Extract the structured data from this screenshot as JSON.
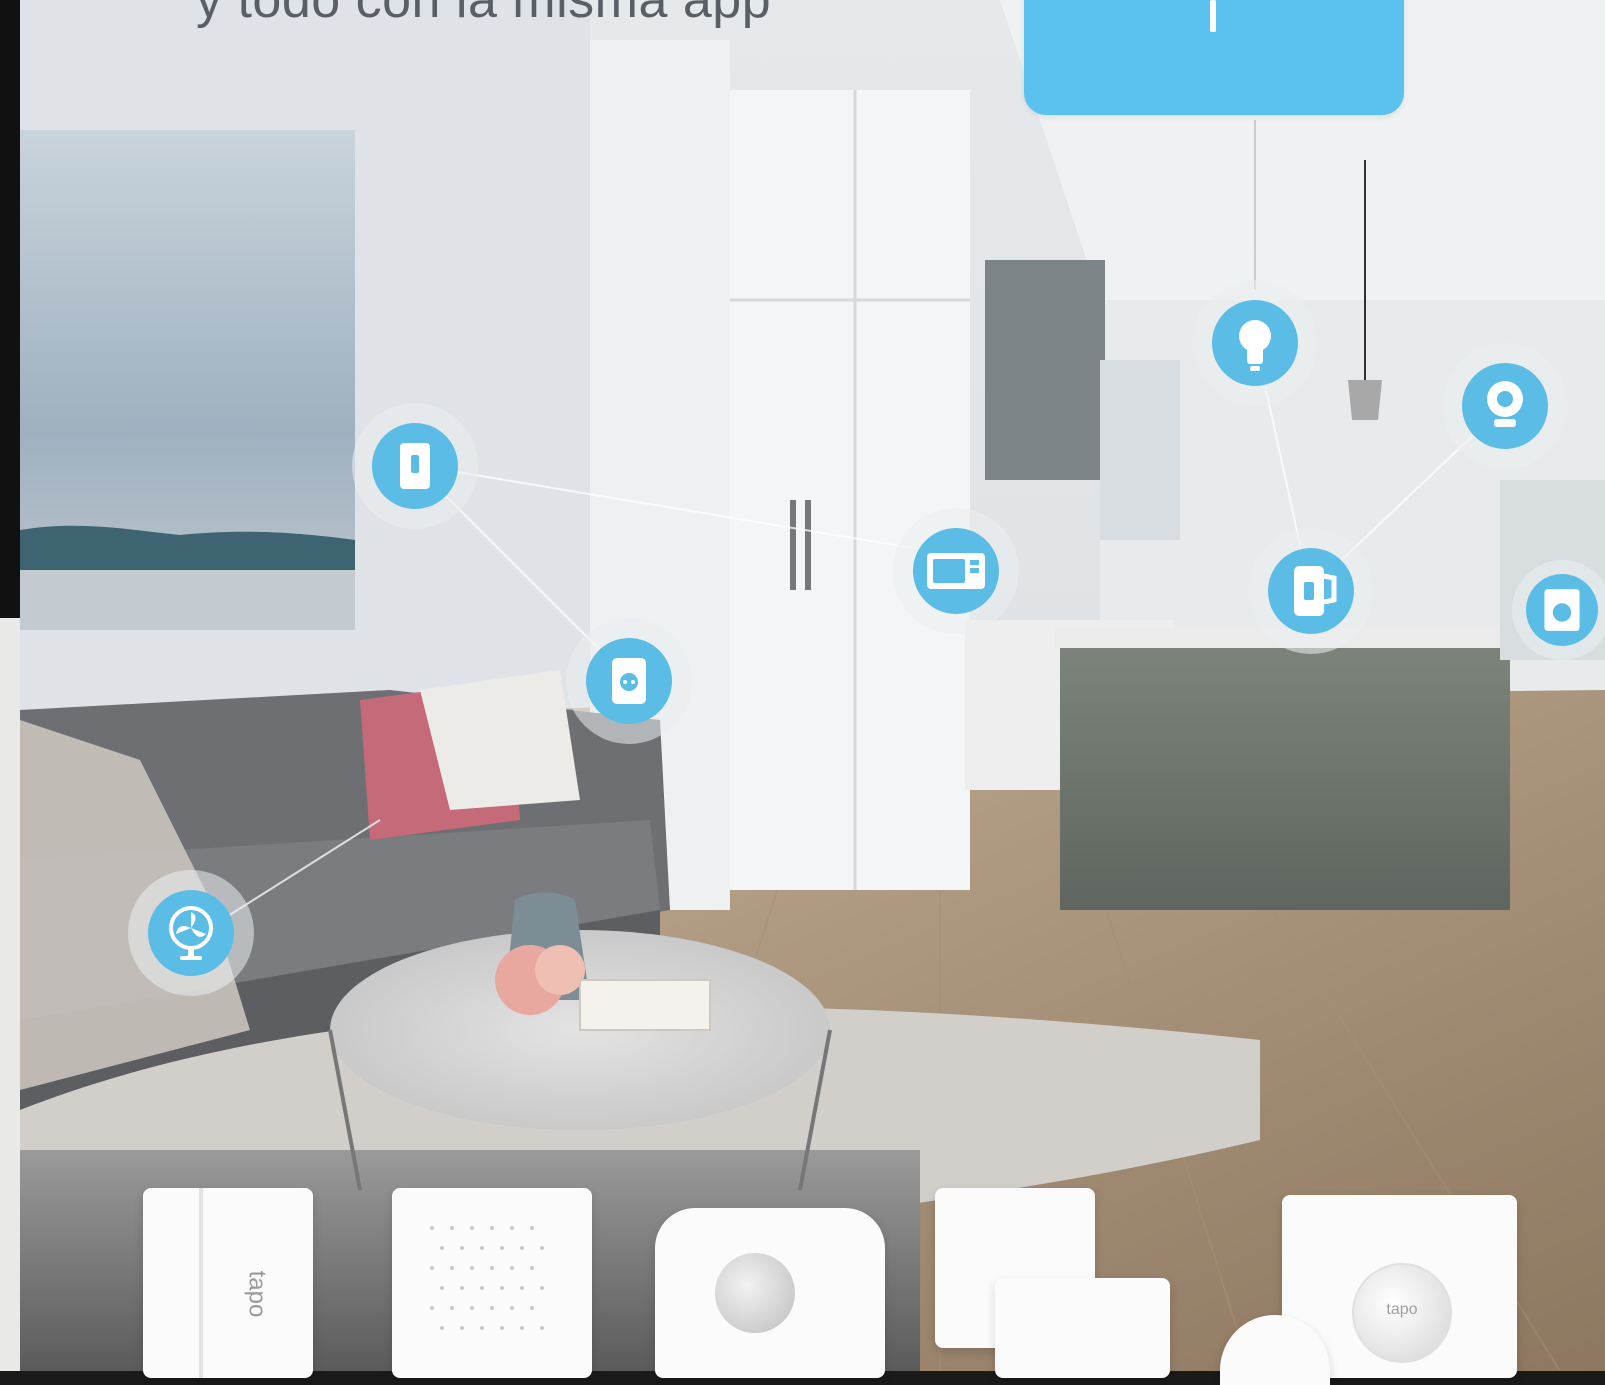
{
  "headline": "y todo con la misma app",
  "brand_text": "tapo",
  "colors": {
    "accent": "#5bc2ef",
    "node_blue": "#5bbce6"
  },
  "devices": [
    {
      "name": "smart-switch-icon"
    },
    {
      "name": "smart-plug-icon"
    },
    {
      "name": "microwave-icon"
    },
    {
      "name": "light-bulb-icon"
    },
    {
      "name": "kettle-icon"
    },
    {
      "name": "camera-icon"
    },
    {
      "name": "washing-machine-icon"
    },
    {
      "name": "fan-icon"
    }
  ],
  "products": [
    {
      "name": "contact-sensor"
    },
    {
      "name": "smart-hub"
    },
    {
      "name": "motion-sensor"
    },
    {
      "name": "door-window-sensor"
    },
    {
      "name": "smart-button"
    }
  ]
}
